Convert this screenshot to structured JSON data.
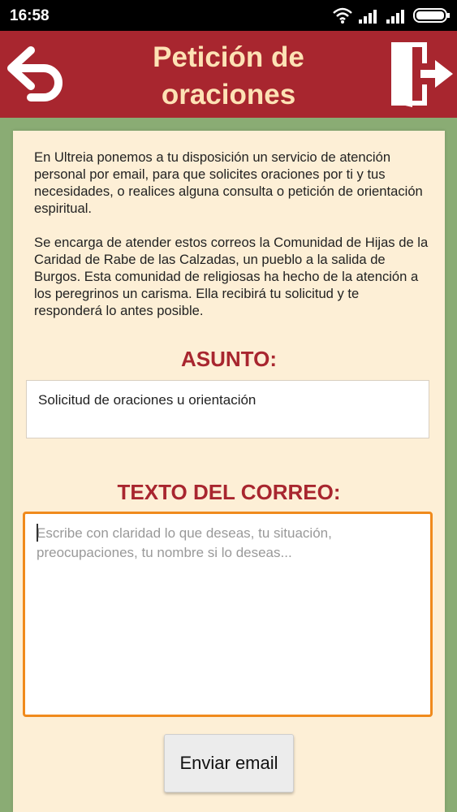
{
  "status_bar": {
    "time": "16:58"
  },
  "app_bar": {
    "title": "Petición de oraciones",
    "back_icon": "back-arrow-icon",
    "exit_icon": "exit-door-icon"
  },
  "intro": {
    "paragraph_1": "En Ultreia ponemos a tu disposición un servicio de atención personal por email, para que solicites oraciones por ti y tus necesidades, o realices alguna consulta o petición de orientación espiritual.",
    "paragraph_2": "Se encarga de atender estos correos la Comunidad de Hijas de la Caridad de Rabe de las Calzadas, un pueblo a la salida de Burgos. Esta comunidad de religiosas ha hecho de la atención a los peregrinos un carisma. Ella recibirá tu solicitud y te responderá lo antes posible."
  },
  "form": {
    "subject_label": "ASUNTO:",
    "subject_value": "Solicitud de oraciones u orientación",
    "body_label": "TEXTO DEL CORREO:",
    "body_placeholder": "Escribe con claridad lo que deseas, tu situación, preocupaciones, tu nombre si lo deseas...",
    "send_label": "Enviar email"
  },
  "colors": {
    "app_bar": "#a8262f",
    "title_text": "#fde2b5",
    "background": "#8aac74",
    "panel": "#fdefd6",
    "focus_border": "#f08a1c"
  }
}
